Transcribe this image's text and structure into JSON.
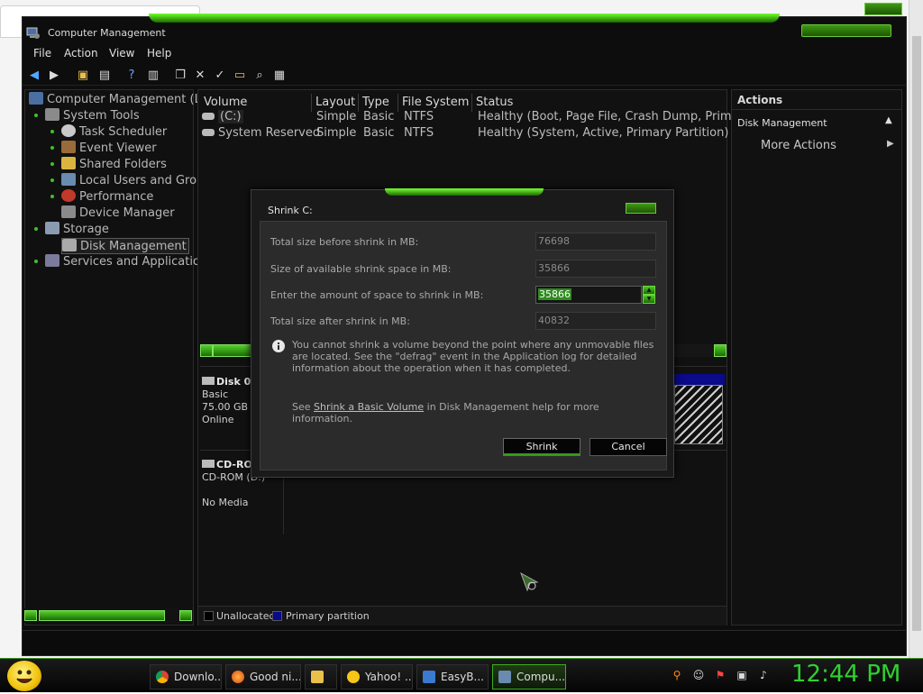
{
  "window": {
    "title": "Computer Management"
  },
  "menu": [
    "File",
    "Action",
    "View",
    "Help"
  ],
  "tree": {
    "root": "Computer Management (Loc",
    "system_tools": "System Tools",
    "task_scheduler": "Task Scheduler",
    "event_viewer": "Event Viewer",
    "shared_folders": "Shared Folders",
    "local_users": "Local Users and Grou",
    "performance": "Performance",
    "device_manager": "Device Manager",
    "storage": "Storage",
    "disk_management": "Disk Management",
    "services": "Services and Applications"
  },
  "volumes": {
    "headers": [
      "Volume",
      "Layout",
      "Type",
      "File System",
      "Status"
    ],
    "rows": [
      [
        "(C:)",
        "Simple",
        "Basic",
        "NTFS",
        "Healthy (Boot, Page File, Crash Dump, Primary"
      ],
      [
        "System Reserved",
        "Simple",
        "Basic",
        "NTFS",
        "Healthy (System, Active, Primary Partition)"
      ]
    ]
  },
  "disks": {
    "disk0": {
      "name": "Disk 0",
      "type": "Basic",
      "size": "75.00 GB",
      "status": "Online"
    },
    "cdrom": {
      "name": "CD-RO",
      "type": "CD-ROM (D:)",
      "status": "No Media"
    }
  },
  "legend": {
    "unallocated": "Unallocated",
    "primary": "Primary partition"
  },
  "actions": {
    "header": "Actions",
    "section": "Disk Management",
    "more": "More Actions"
  },
  "dialog": {
    "title": "Shrink C:",
    "total_label": "Total size before shrink in MB:",
    "total_value": "76698",
    "available_label": "Size of available shrink space in MB:",
    "available_value": "35866",
    "amount_label": "Enter the amount of space to shrink in MB:",
    "amount_value": "35866",
    "after_label": "Total size after shrink in MB:",
    "after_value": "40832",
    "info_text": "You cannot shrink a volume beyond the point where any unmovable files are located. See the \"defrag\" event in the Application log for detailed information about the operation when it has completed.",
    "help_prefix": "See ",
    "help_link": "Shrink a Basic Volume",
    "help_suffix": " in Disk Management help for more information.",
    "shrink_button": "Shrink",
    "cancel_button": "Cancel"
  },
  "taskbar": {
    "items": [
      "Downlo...",
      "Good ni...",
      "",
      "Yahoo! ...",
      "EasyB...",
      "Compu..."
    ],
    "clock": "12:44 PM"
  },
  "colors": {
    "accent": "#3fc12a",
    "clock": "#2fd12f",
    "primary_partition": "#0a0a8a"
  }
}
